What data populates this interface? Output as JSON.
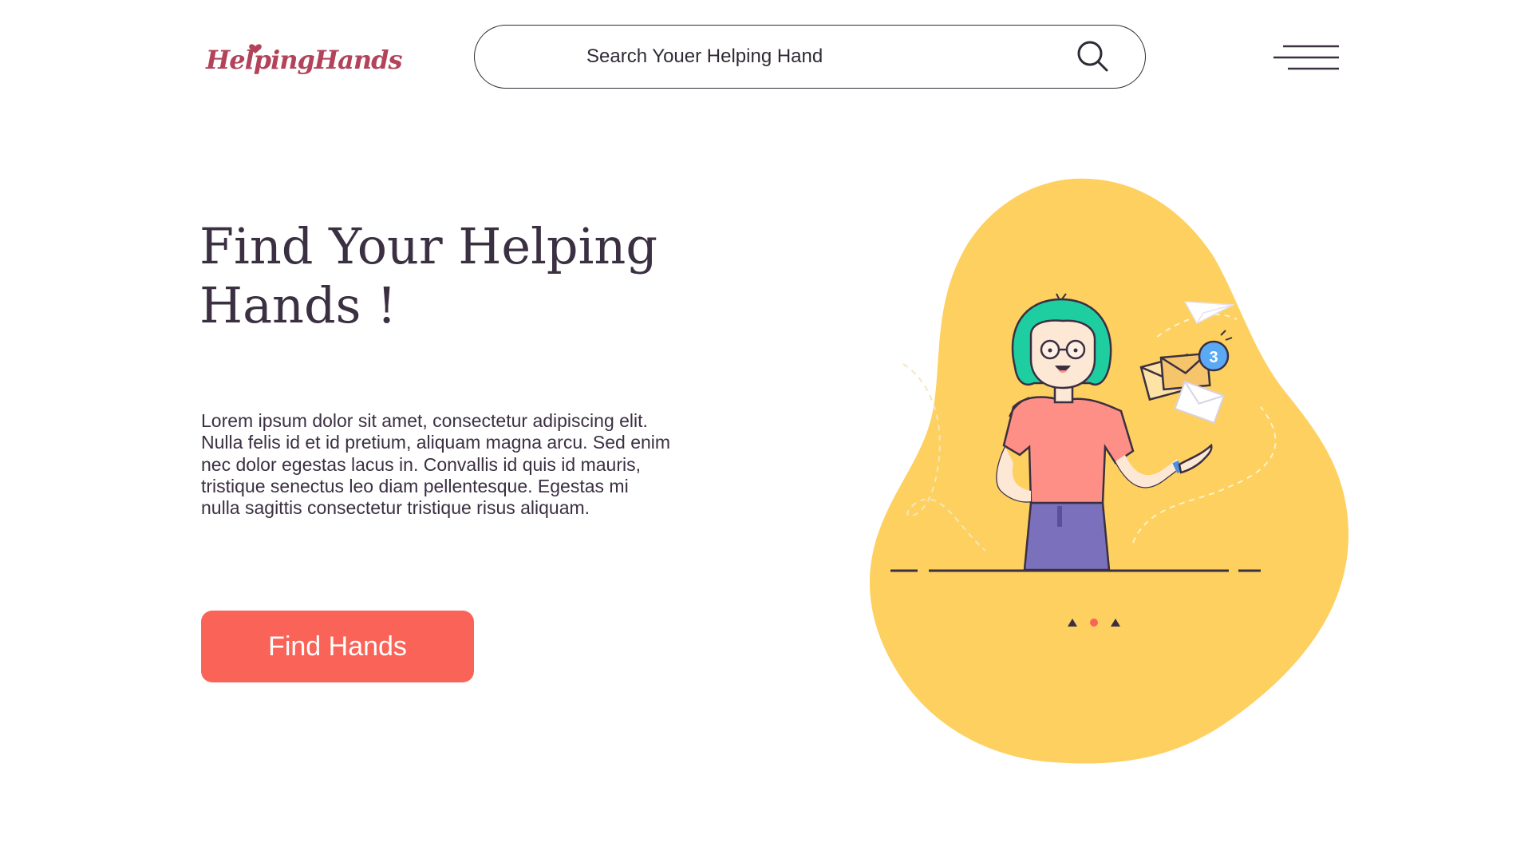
{
  "header": {
    "logo_text": "HelpingHands",
    "search": {
      "placeholder": "Search Youer Helping Hand",
      "value": ""
    }
  },
  "hero": {
    "title": "Find Your Helping Hands !",
    "body": "Lorem ipsum dolor sit amet, consectetur adipiscing elit. Nulla felis id et id pretium, aliquam magna arcu. Sed enim nec dolor egestas lacus in. Convallis id quis id mauris, tristique senectus leo diam pellentesque. Egestas mi nulla sagittis consectetur tristique risus aliquam.",
    "cta_label": "Find Hands"
  },
  "illustration": {
    "notification_count": "3"
  },
  "carousel": {
    "active_index": 1,
    "count": 3
  },
  "colors": {
    "accent": "#fa6358",
    "blob": "#fdd05f",
    "text": "#3b2f42",
    "logo": "#b2435a"
  },
  "icons": [
    "search-icon",
    "hamburger-menu-icon",
    "logo-heart-icon"
  ]
}
